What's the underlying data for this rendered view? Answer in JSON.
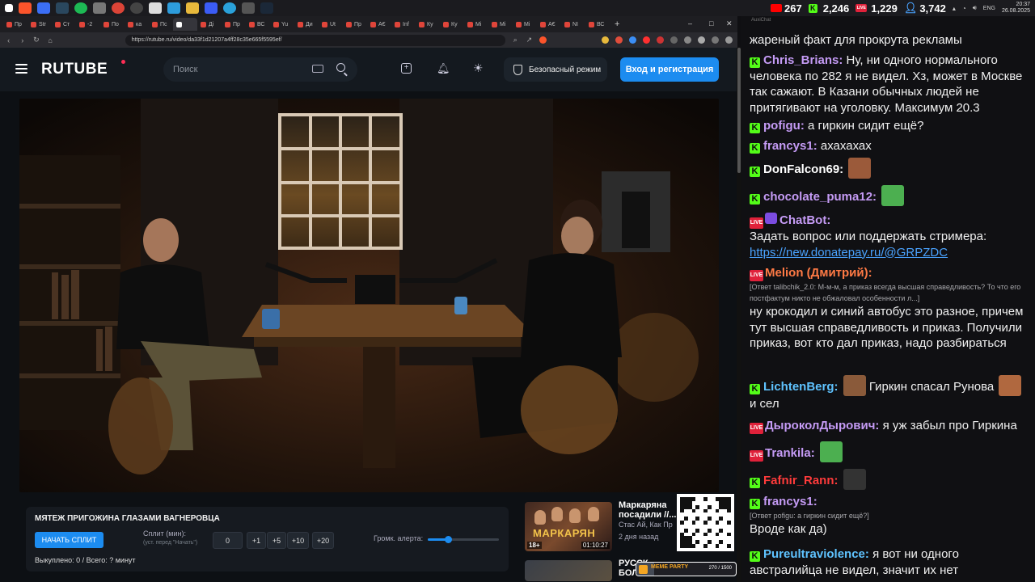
{
  "tray": {
    "viewers_youtube": "267",
    "viewers_kick": "2,246",
    "viewers_vk": "1,229",
    "viewers_total": "3,742",
    "lang": "ENG",
    "time": "20:37",
    "date": "26.08.2025"
  },
  "browser": {
    "tabs": [
      "Пр",
      "Str",
      "Ст",
      "-2",
      "По",
      "ка",
      "Пс",
      "",
      "Ді",
      "Пр",
      "ВС",
      "Yu",
      "Ди",
      "Ut",
      "Пр",
      "А€",
      "Inf",
      "Ку",
      "Ку",
      "Mi",
      "Mi",
      "Mi",
      "А€",
      "NI",
      "ВС"
    ],
    "active_tab_index": 7,
    "new_tab": "+",
    "url": "https://rutube.ru/video/da33f1d21207a4ff28c35e665f5595ef/"
  },
  "rutube": {
    "logo": "RUTUBE",
    "search_placeholder": "Поиск",
    "safe_mode": "Безопасный режим",
    "login": "Вход и регистрация"
  },
  "stream_panel": {
    "title": "МЯТЕЖ ПРИГОЖИНА ГЛАЗАМИ ВАГНЕРОВЦА",
    "split_button": "НАЧАТЬ СПЛИТ",
    "split_label": "Сплит (мин):",
    "split_hint": "(уст. перед \"Начать\")",
    "split_value": "0",
    "increments": [
      "+1",
      "+5",
      "+10",
      "+20"
    ],
    "volume_label": "Громк. алерта:",
    "volume_level": 0.28,
    "bought": "Выкуплено: 0 / Всего: ? минут"
  },
  "recommended": [
    {
      "title_line1": "Маркаряна",
      "title_line2": "посадили //...",
      "channel": "Стас Ай, Как Пр",
      "age": "2 дня назад",
      "thumb_brand": "МАРКАРЯН",
      "age_rating": "18+",
      "duration": "01:10:27"
    },
    {
      "title_line1": "РУССК",
      "title_line2": "БОЛ"
    }
  ],
  "meme_party": {
    "label": "MEME PARTY",
    "count": "270 / 1500",
    "progress": 0.18
  },
  "chat": {
    "title": "AuxiChat",
    "colors": {
      "kick": "#53fc18",
      "live": "#e0213a",
      "link": "#4aa3ff"
    },
    "messages": [
      {
        "text": "жареный факт для прокрута рекламы"
      },
      {
        "user": "Chris_Brians:",
        "color": "#c59bf5",
        "platform": "kick",
        "text": "Ну, ни одного нормального человека по 282 я не видел. Хз, может в Москве так сажают. В Казани обычных людей не притягивают на уголовку. Максимум 20.3"
      },
      {
        "user": "pofigu:",
        "color": "#c59bf5",
        "platform": "kick",
        "text": "а гиркин сидит ещё?"
      },
      {
        "user": "francys1:",
        "color": "#c59bf5",
        "platform": "kick",
        "text": "ахахахах"
      },
      {
        "user": "DonFalcon69:",
        "color": "#ffffff",
        "platform": "kick",
        "text": "",
        "emote": "face-emote"
      },
      {
        "user": "chocolate_puma12:",
        "color": "#c59bf5",
        "platform": "kick",
        "text": "",
        "emote": "pepe-emote"
      },
      {
        "user": "ChatBot:",
        "color": "#c59bf5",
        "platform": "live",
        "text": "Задать вопрос или поддержать стримера:",
        "link": "https://new.donatepay.ru/@GRPZDC"
      },
      {
        "user": "Melion (Дмитрий):",
        "color": "#ff7a45",
        "platform": "live",
        "reply": "[Ответ talibchik_2.0: М-м-м, а приказ всегда высшая справедливость? То что его постфактум никто не обжаловал особенности л...]",
        "text": "ну крокодил и синий автобус это разное, причем тут высшая справедливость и приказ. Получили приказ, вот кто дал приказ, надо разбираться"
      },
      {
        "user": "LichtenBerg:",
        "color": "#5fc3ff",
        "platform": "kick",
        "text": "Гиркин спасал Рунова",
        "text2": "и сел"
      },
      {
        "user": "ДыроколДырович:",
        "color": "#c59bf5",
        "platform": "live",
        "text": "я уж забыл про Гиркина"
      },
      {
        "user": "Trankila:",
        "color": "#c59bf5",
        "platform": "live",
        "text": "",
        "emote": "pepe-emote"
      },
      {
        "user": "Fafnir_Rann:",
        "color": "#ff3b3b",
        "platform": "kick",
        "text": "",
        "emote": "dark-emote"
      },
      {
        "user": "francys1:",
        "color": "#c59bf5",
        "platform": "kick",
        "reply": "[Ответ pofigu: а гиркин сидит ещё?]",
        "text": "Вроде как да)"
      },
      {
        "user": "Pureultraviolence:",
        "color": "#5fc3ff",
        "platform": "kick",
        "text": "я вот ни одного австралийца не видел, значит их нет"
      }
    ]
  }
}
